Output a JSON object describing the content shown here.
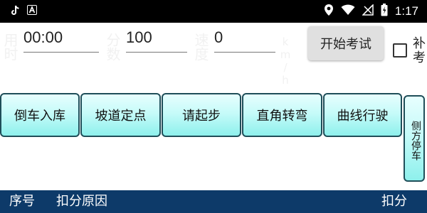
{
  "statusbar": {
    "left_icons": [
      "tiktok-icon",
      "a-badge-icon"
    ],
    "right_icons": [
      "location-icon",
      "wifi-icon",
      "signal-icon",
      "battery-icon"
    ],
    "time": "1:17"
  },
  "form": {
    "time_label": "用时",
    "time_value": "00:00",
    "score_label": "分数",
    "score_value": "100",
    "speed_label": "速度",
    "speed_value": "0",
    "speed_unit": "km/h",
    "start_button": "开始考试",
    "retake_label": "补考",
    "retake_checked": false
  },
  "actions": [
    {
      "label": "倒车入库"
    },
    {
      "label": "坡道定点"
    },
    {
      "label": "请起步"
    },
    {
      "label": "直角转弯"
    },
    {
      "label": "曲线行驶"
    },
    {
      "label": "侧方停车"
    }
  ],
  "table": {
    "headers": {
      "index": "序号",
      "reason": "扣分原因",
      "points": "扣分"
    }
  },
  "colors": {
    "statusbar": "#000000",
    "bottombar": "#0d3a69",
    "button_border": "#1f4e59",
    "button_fill": "#c6fbf9"
  }
}
